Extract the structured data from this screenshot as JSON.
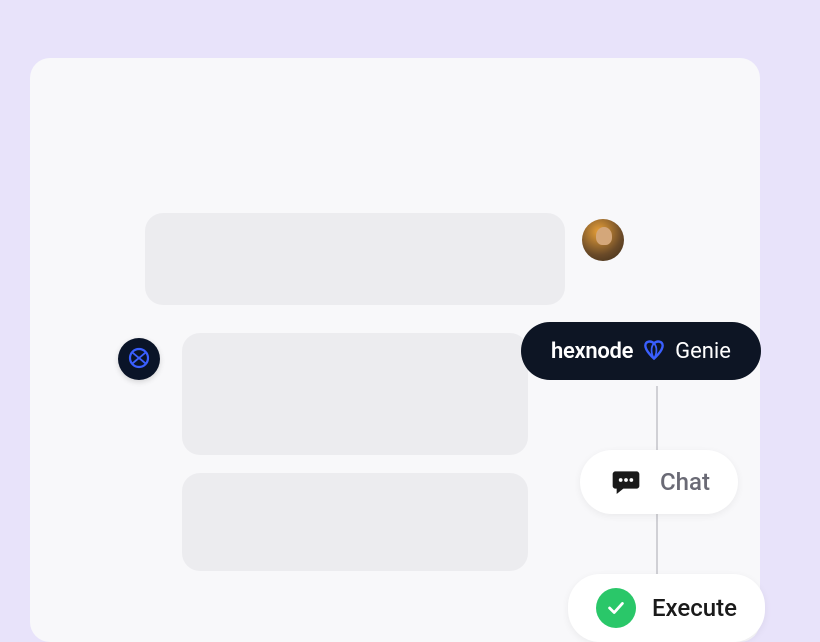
{
  "genie": {
    "brand": "hexnode",
    "name": "Genie"
  },
  "actions": {
    "chat_label": "Chat",
    "execute_label": "Execute"
  },
  "icons": {
    "bot_logo": "hexnode-logo-icon",
    "chat": "chat-bubble-icon",
    "execute": "checkmark-icon"
  },
  "colors": {
    "background": "#e8e3fa",
    "card": "#f8f8fa",
    "message": "#ececef",
    "genie_pill": "#0d1524",
    "execute_green": "#2ac769",
    "logo_blue": "#3a5fff"
  }
}
